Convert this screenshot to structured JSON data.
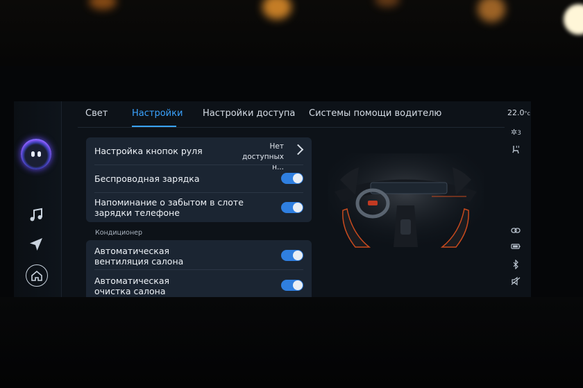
{
  "tabs": [
    {
      "label": "Свет",
      "active": false
    },
    {
      "label": "Настройки",
      "active": true
    },
    {
      "label": "Настройки доступа",
      "active": false
    },
    {
      "label": "Системы помощи водителю",
      "active": false
    }
  ],
  "settings_group_main": {
    "steering_buttons": {
      "label": "Настройка кнопок руля",
      "value_line1": "Нет",
      "value_line2": "доступных н..."
    },
    "wireless_charging": {
      "label": "Беспроводная зарядка",
      "enabled": true
    },
    "phone_reminder": {
      "label_line1": "Напоминание о забытом в слоте",
      "label_line2": "зарядки телефоне",
      "enabled": true
    }
  },
  "section_ac": {
    "label": "Кондиционер"
  },
  "settings_group_ac": {
    "auto_ventilation": {
      "label_line1": "Автоматическая",
      "label_line2": "вентиляция салона",
      "enabled": true
    },
    "auto_cleaning": {
      "label_line1": "Автоматическая",
      "label_line2": "очистка салона",
      "enabled": true
    }
  },
  "status_bar": {
    "temperature": "22.0",
    "temperature_unit": "°c",
    "fan_level": "3"
  },
  "icons": [
    "music-note-icon",
    "navigation-arrow-icon",
    "home-icon",
    "fan-icon",
    "seat-heat-icon",
    "link-icon",
    "battery-icon",
    "bluetooth-icon",
    "mute-icon"
  ],
  "colors": {
    "accent": "#3aa3ff",
    "toggle_on": "#2f7fe0",
    "card": "#1b2532",
    "background": "#0d1218"
  }
}
